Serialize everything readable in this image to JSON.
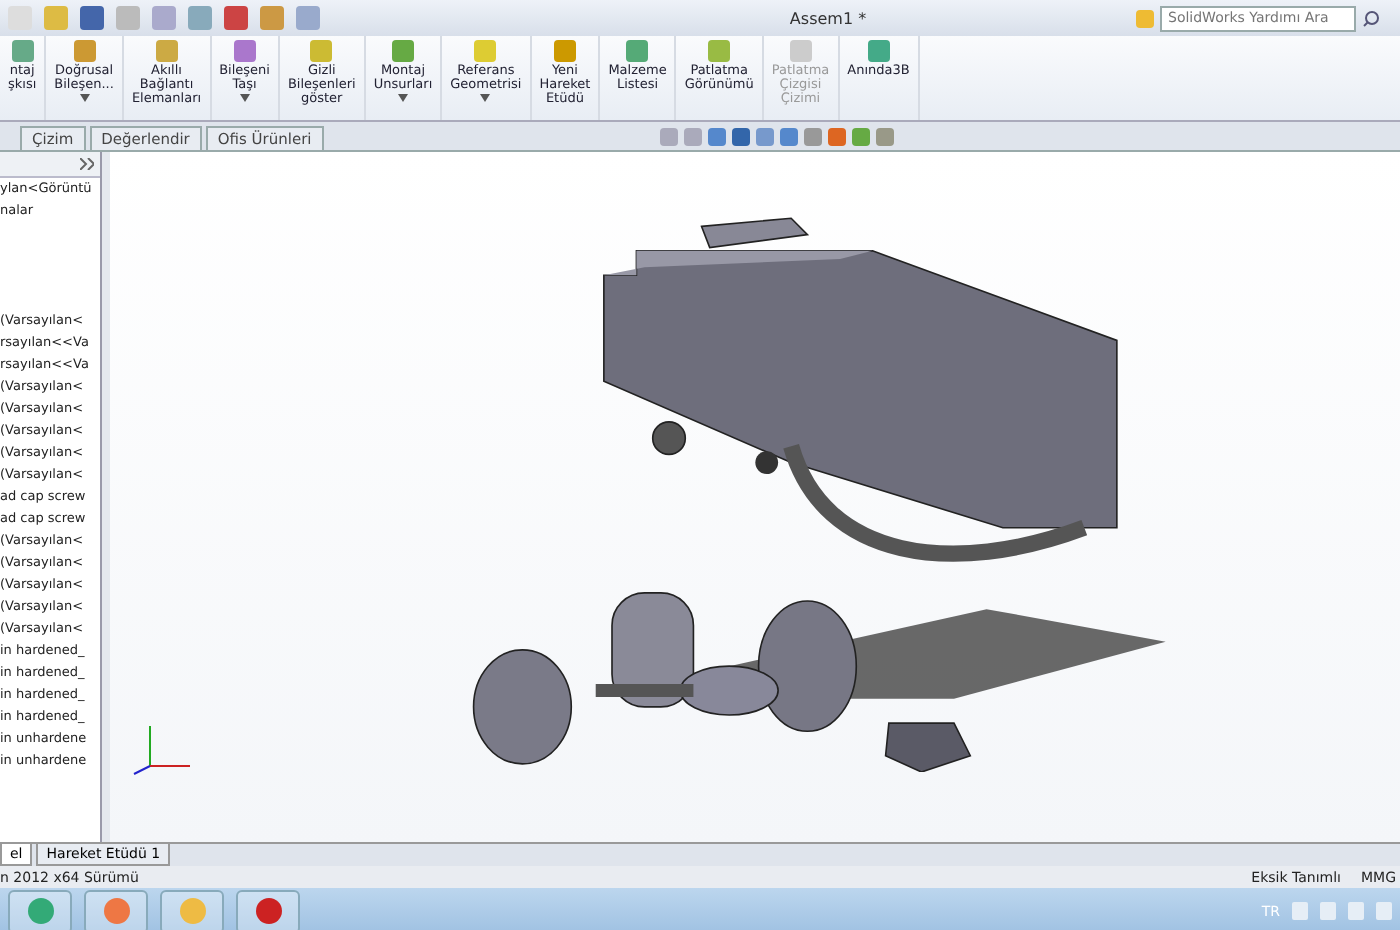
{
  "window": {
    "title": "Assem1 *",
    "search": {
      "placeholder": "SolidWorks Yardımı Ara"
    }
  },
  "ribbon": {
    "buttons": [
      {
        "label": "ntaj\nşkısı",
        "dropdown": false,
        "disabled": false
      },
      {
        "label": "Doğrusal\nBileşen...",
        "dropdown": true,
        "disabled": false
      },
      {
        "label": "Akıllı\nBağlantı\nElemanları",
        "dropdown": false,
        "disabled": false
      },
      {
        "label": "Bileşeni\nTaşı",
        "dropdown": true,
        "disabled": false
      },
      {
        "label": "Gizli\nBileşenleri\ngöster",
        "dropdown": false,
        "disabled": false
      },
      {
        "label": "Montaj\nUnsurları",
        "dropdown": true,
        "disabled": false
      },
      {
        "label": "Referans\nGeometrisi",
        "dropdown": true,
        "disabled": false
      },
      {
        "label": "Yeni\nHareket\nEtüdü",
        "dropdown": false,
        "disabled": false
      },
      {
        "label": "Malzeme\nListesi",
        "dropdown": false,
        "disabled": false
      },
      {
        "label": "Patlatma\nGörünümü",
        "dropdown": false,
        "disabled": false
      },
      {
        "label": "Patlatma\nÇizgisi\nÇizimi",
        "dropdown": false,
        "disabled": true
      },
      {
        "label": "Anında3B",
        "dropdown": false,
        "disabled": false
      }
    ]
  },
  "tabs": [
    {
      "label": "Çizim",
      "selected": false
    },
    {
      "label": "Değerlendir",
      "selected": false
    },
    {
      "label": "Ofis Ürünleri",
      "selected": false
    }
  ],
  "feature_tree": {
    "items": [
      "ylan<Görüntü",
      "nalar",
      "(Varsayılan<",
      "rsayılan<<Va",
      "rsayılan<<Va",
      "(Varsayılan<",
      "(Varsayılan<",
      "(Varsayılan<",
      "(Varsayılan<",
      "(Varsayılan<",
      "ad cap screw",
      "ad cap screw",
      "(Varsayılan<",
      "(Varsayılan<",
      "(Varsayılan<",
      "(Varsayılan<",
      "(Varsayılan<",
      "in hardened_",
      "in hardened_",
      "in hardened_",
      "in hardened_",
      "in unhardene",
      "in unhardene"
    ]
  },
  "bottom_tabs": [
    {
      "label": "el",
      "selected": true
    },
    {
      "label": "Hareket Etüdü 1",
      "selected": false
    }
  ],
  "status_bar": {
    "version": "n 2012 x64 Sürümü",
    "state": "Eksik Tanımlı",
    "units": "MMG"
  },
  "taskbar": {
    "language": "TR"
  }
}
